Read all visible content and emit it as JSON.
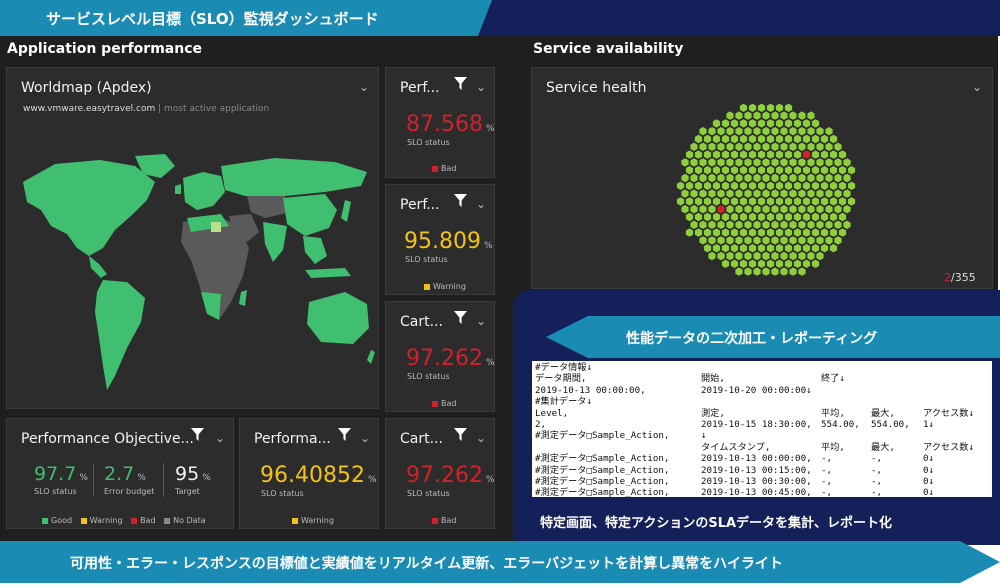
{
  "banner": {
    "title": "サービスレベル目標（SLO）監視ダッシュボード"
  },
  "sections": {
    "app_perf": "Application performance",
    "availability": "Service availability"
  },
  "worldmap": {
    "title": "Worldmap (Apdex)",
    "domain": "www.vmware.easytravel.com",
    "separator": " | ",
    "note": "most active application"
  },
  "perf_tiles": [
    {
      "title": "Perf...",
      "value": "87.568",
      "unit": "%",
      "status": "SLO status",
      "legend": "Bad",
      "color": "#d1222c"
    },
    {
      "title": "Perf...",
      "value": "95.809",
      "unit": "%",
      "status": "SLO status",
      "legend": "Warning",
      "color": "#f2c21a"
    },
    {
      "title": "Cart...",
      "value": "97.262",
      "unit": "%",
      "status": "SLO status",
      "legend": "Bad",
      "color": "#d1222c"
    }
  ],
  "bottom_tiles": {
    "objective": {
      "title": "Performance Objective...",
      "metrics": [
        {
          "value": "97.7",
          "unit": "%",
          "label": "SLO status"
        },
        {
          "value": "2.7",
          "unit": "%",
          "label": "Error budget"
        },
        {
          "value": "95",
          "unit": "%",
          "label": "Target"
        }
      ],
      "legend": [
        "Good",
        "Warning",
        "Bad",
        "No Data"
      ]
    },
    "performa": {
      "title": "Performa...",
      "value": "96.40852",
      "unit": "%",
      "status": "SLO status",
      "legend": "Warning"
    },
    "cart": {
      "title": "Cart...",
      "value": "97.262",
      "unit": "%",
      "status": "SLO status",
      "legend": "Bad"
    }
  },
  "service_health": {
    "title": "Service health",
    "count_bad": "2",
    "count_total": "/355"
  },
  "report": {
    "banner": "性能データの二次加工・レポーティング",
    "caption": "特定画面、特定アクションのSLAデータを集計、レポート化",
    "rows": [
      [
        "#データ情報↓",
        "",
        "",
        "",
        ""
      ],
      [
        "データ期間,",
        "開始,",
        "終了↓",
        "",
        ""
      ],
      [
        "2019-10-13 00:00:00,",
        "2019-10-20 00:00:00↓",
        "",
        "",
        ""
      ],
      [
        "#集計データ↓",
        "",
        "",
        "",
        ""
      ],
      [
        "Level,",
        "測定,",
        "平均,",
        "最大,",
        "アクセス数↓"
      ],
      [
        "2,",
        "2019-10-15 18:30:00,",
        "554.00,",
        "554.00,",
        "1↓"
      ],
      [
        "#測定データ□Sample_Action,",
        "↓",
        "",
        "",
        ""
      ],
      [
        "",
        "タイムスタンプ,",
        "平均,",
        "最大,",
        "アクセス数↓"
      ],
      [
        "#測定データ□Sample_Action,",
        "2019-10-13 00:00:00,",
        "-,",
        "-,",
        "0↓"
      ],
      [
        "#測定データ□Sample_Action,",
        "2019-10-13 00:15:00,",
        "-,",
        "-,",
        "0↓"
      ],
      [
        "#測定データ□Sample_Action,",
        "2019-10-13 00:30:00,",
        "-,",
        "-,",
        "0↓"
      ],
      [
        "#測定データ□Sample_Action,",
        "2019-10-13 00:45:00,",
        "-,",
        "-,",
        "0↓"
      ]
    ]
  },
  "footer": {
    "text": "可用性・エラー・レスポンスの目標値と実績値をリアルタイム更新、エラーバジェットを計算し異常をハイライト"
  },
  "colors": {
    "good": "#3fbf6f",
    "warning": "#f2c21a",
    "bad": "#d1222c",
    "nodata": "#8a8a8a",
    "accent": "#1a8bb3",
    "navy": "#14205a"
  }
}
